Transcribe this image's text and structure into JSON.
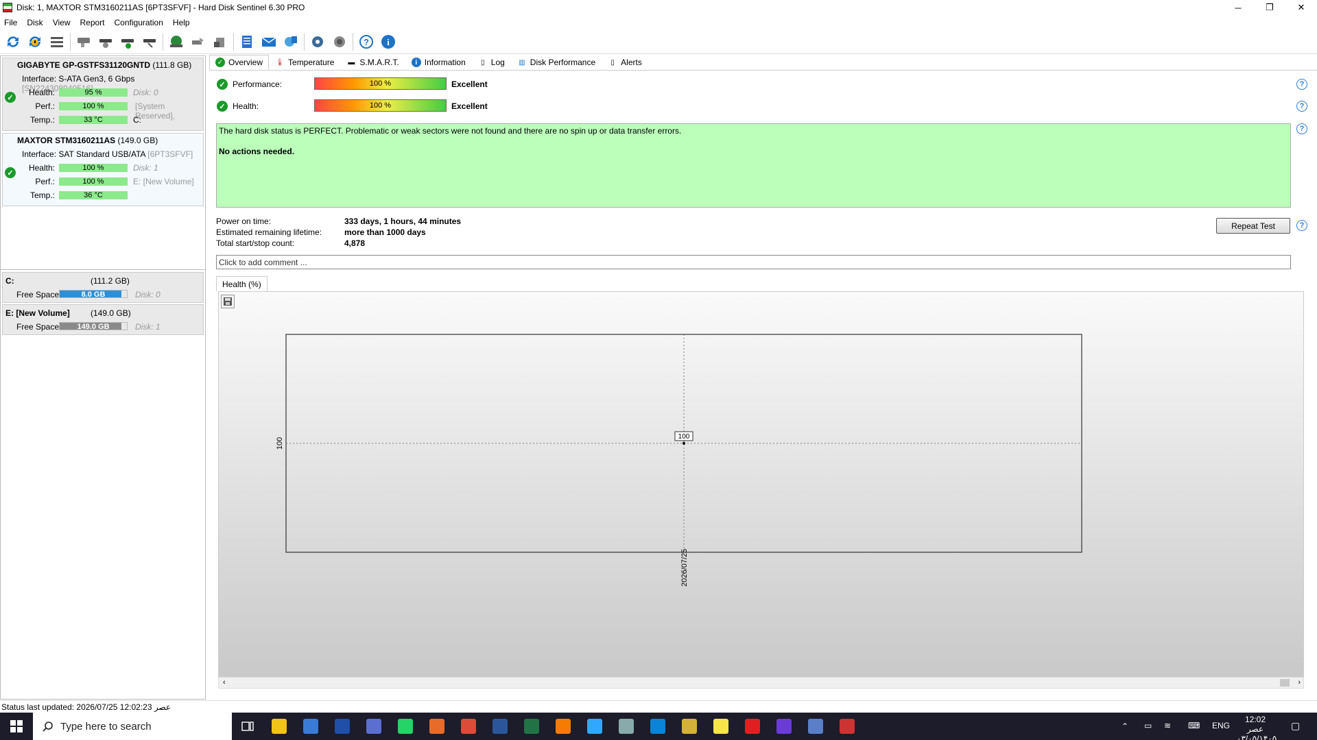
{
  "window": {
    "title": "Disk: 1, MAXTOR STM3160211AS [6PT3SFVF]  -  Hard Disk Sentinel 6.30 PRO",
    "controls": [
      "─",
      "❐",
      "✕"
    ]
  },
  "menu": [
    "File",
    "Disk",
    "View",
    "Report",
    "Configuration",
    "Help"
  ],
  "disks": [
    {
      "name": "GIGABYTE GP-GSTFS31120GNTD",
      "size": "(111.8 GB)",
      "interface_label": "Interface:",
      "interface": "S-ATA Gen3, 6 Gbps",
      "serial": "[SN224308940516]",
      "health_label": "Health:",
      "health": "95 %",
      "health_value": 95,
      "perf_label": "Perf.:",
      "perf": "100 %",
      "perf_value": 100,
      "temp_label": "Temp.:",
      "temp": "33 °C",
      "disk_no": "Disk: 0",
      "partition1": "[System Reserved],",
      "partition2": "C:"
    },
    {
      "name": "MAXTOR STM3160211AS",
      "size": "(149.0 GB)",
      "interface_label": "Interface:",
      "interface": "SAT Standard USB/ATA",
      "serial": "[6PT3SFVF]",
      "health_label": "Health:",
      "health": "100 %",
      "health_value": 100,
      "perf_label": "Perf.:",
      "perf": "100 %",
      "perf_value": 100,
      "temp_label": "Temp.:",
      "temp": "36 °C",
      "disk_no": "Disk: 1",
      "partition1": "E: [New Volume]"
    }
  ],
  "volumes": [
    {
      "name": "C:",
      "size": "(111.2 GB)",
      "free_label": "Free Space",
      "free": "8.0 GB",
      "free_fraction": 0.92,
      "disk_no": "Disk: 0",
      "bar_color": "#2d8fd6"
    },
    {
      "name": "E: [New Volume]",
      "size": "(149.0 GB)",
      "free_label": "Free Space",
      "free": "149.0 GB",
      "free_fraction": 0.92,
      "disk_no": "Disk: 1",
      "bar_color": "#8a8a8a"
    }
  ],
  "tabs": [
    "Overview",
    "Temperature",
    "S.M.A.R.T.",
    "Information",
    "Log",
    "Disk Performance",
    "Alerts"
  ],
  "overview": {
    "performance_label": "Performance:",
    "performance_value": "100 %",
    "performance_text": "Excellent",
    "health_label": "Health:",
    "health_value": "100 %",
    "health_text": "Excellent",
    "status_line1": "The hard disk status is PERFECT. Problematic or weak sectors were not found and there are no spin up or data transfer errors.",
    "status_line2": "No actions needed.",
    "power_on_label": "Power on time:",
    "power_on_value": "333 days, 1 hours, 44 minutes",
    "lifetime_label": "Estimated remaining lifetime:",
    "lifetime_value": "more than 1000 days",
    "startstop_label": "Total start/stop count:",
    "startstop_value": "4,878",
    "repeat_button": "Repeat Test",
    "comment_placeholder": "Click to add comment ..."
  },
  "graph": {
    "tab_label": "Health (%)"
  },
  "chart_data": {
    "type": "line",
    "x": [
      "2026/07/25"
    ],
    "series": [
      {
        "values": [
          100
        ]
      }
    ],
    "ytick": "100",
    "data_label": "100"
  },
  "status_bar": "Status last updated: 2026/07/25 12:02:23 عصر",
  "taskbar": {
    "search_placeholder": "Type here to search",
    "lang": "ENG",
    "time": "12:02 عصر",
    "date": "۰۳/۰۵/۱۴۰۵",
    "apps": [
      "#f2c318",
      "#3a7bd5",
      "#1f4fa8",
      "#5b6fd1",
      "#25d366",
      "#e86b2a",
      "#dd4b39",
      "#2b579a",
      "#217346",
      "#f57c00",
      "#31a8ff",
      "#8aa",
      "#0a84d6",
      "#d4b23a",
      "#f7e54a",
      "#e02020",
      "#6a3bd6",
      "#5a7fc8",
      "#c33"
    ]
  }
}
